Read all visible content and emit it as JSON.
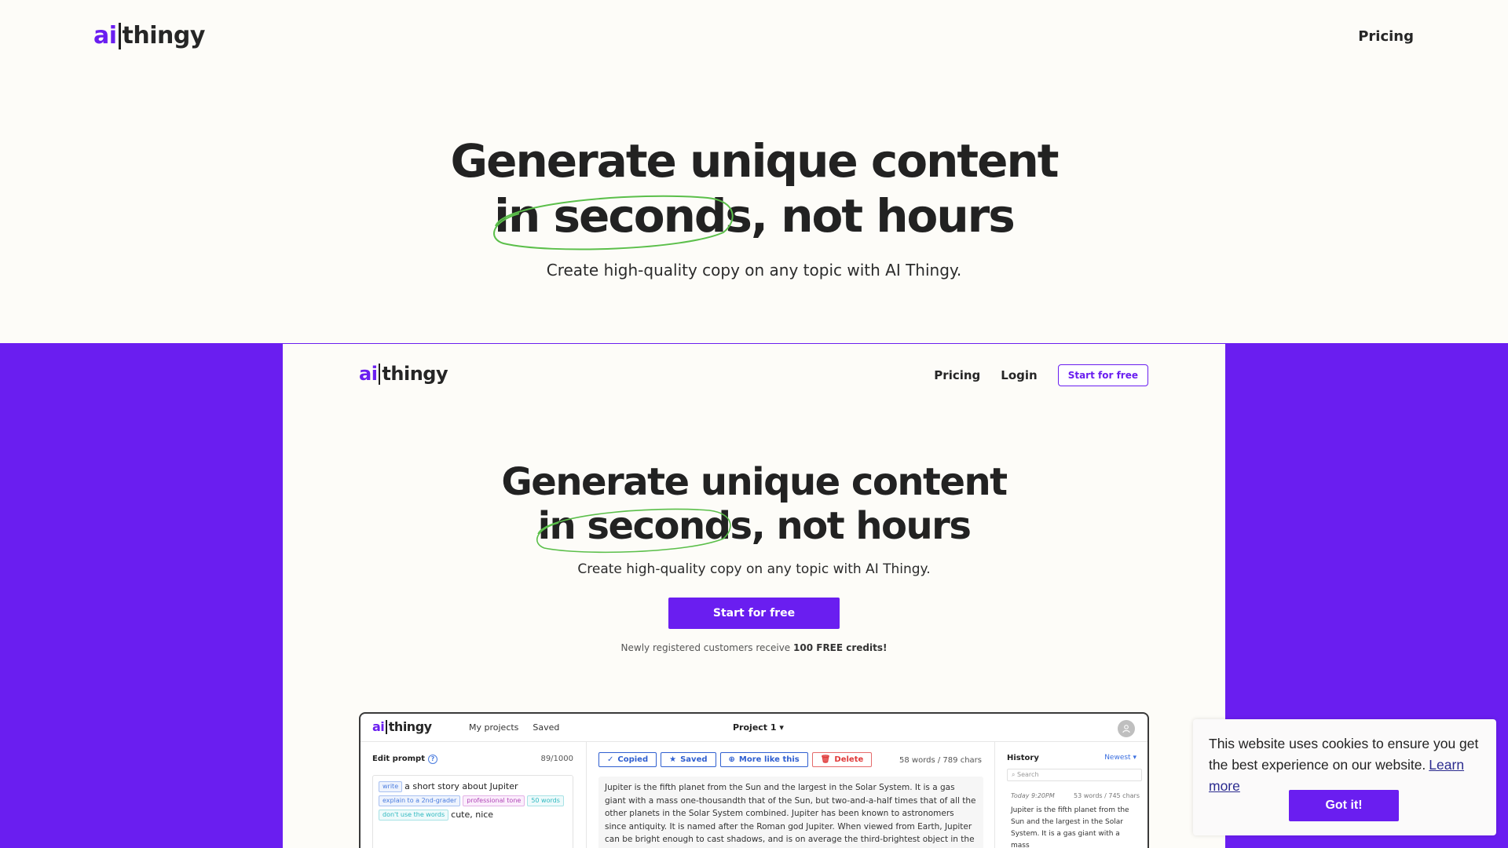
{
  "outer": {
    "logo": {
      "ai": "ai",
      "thingy": "thingy"
    },
    "nav": {
      "pricing": "Pricing"
    },
    "hero": {
      "line1": "Generate unique content",
      "highlight": "in seconds",
      "line2_rest": ", not hours",
      "subtitle": "Create high-quality copy on any topic with AI Thingy."
    }
  },
  "inner": {
    "logo": {
      "ai": "ai",
      "thingy": "thingy"
    },
    "nav": {
      "pricing": "Pricing",
      "login": "Login",
      "start": "Start for free"
    },
    "hero": {
      "line1": "Generate unique content",
      "highlight": "in seconds",
      "line2_rest": ", not hours",
      "subtitle": "Create high-quality copy on any topic with AI Thingy.",
      "cta": "Start for free",
      "note_prefix": "Newly registered customers receive ",
      "note_bold": "100 FREE credits!"
    }
  },
  "app": {
    "logo": {
      "ai": "ai",
      "thingy": "thingy"
    },
    "tabs": [
      "My projects",
      "Saved"
    ],
    "project": "Project 1",
    "edit_prompt": {
      "label": "Edit prompt",
      "count": "89/1000",
      "tag_write": "write",
      "topic": "a short story about Jupiter",
      "tag_explain": "explain to a 2nd-grader",
      "tag_tone": "professional tone",
      "tag_words": "50 words",
      "tag_dont": "don't use the words",
      "dont_words": "cute, nice"
    },
    "actions": {
      "copied": "Copied",
      "saved": "Saved",
      "more": "More like this",
      "delete": "Delete"
    },
    "word_count": "58 words / 789 chars",
    "output": "Jupiter is the fifth planet from the Sun and the largest in the Solar System. It is a gas giant with a mass one-thousandth that of the Sun, but two-and-a-half times that of all the other planets in the Solar System combined. Jupiter has been known to astronomers since antiquity. It is named after the Roman god Jupiter. When viewed from Earth, Jupiter can be bright enough to cast shadows, and is on average the third-brightest object in the night sky",
    "history": {
      "label": "History",
      "sort": "Newest",
      "search_placeholder": "Search",
      "time": "Today 9:20PM",
      "stats": "53 words / 745 chars",
      "text": "Jupiter is the fifth planet from the Sun and the largest in the Solar System. It is a gas giant with a mass"
    }
  },
  "cookie": {
    "text": "This website uses cookies to ensure you get the best experience on our website.",
    "link": "Learn more",
    "button": "Got it!"
  },
  "colors": {
    "brand": "#6a1ef0",
    "highlight_stroke": "#5bbf4a"
  }
}
